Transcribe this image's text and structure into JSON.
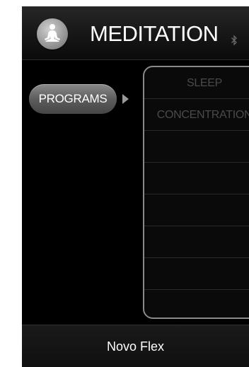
{
  "header": {
    "title": "MEDITATION",
    "logo_icon": "meditation-figure-icon",
    "status_icon": "bluetooth-icon"
  },
  "menu": {
    "selected_tab": "PROGRAMS",
    "arrow_icon": "triangle-right-icon"
  },
  "programs": {
    "items": [
      {
        "label": "SLEEP"
      },
      {
        "label": "CONCENTRATION"
      },
      {
        "label": ""
      },
      {
        "label": ""
      },
      {
        "label": ""
      },
      {
        "label": ""
      },
      {
        "label": ""
      },
      {
        "label": ""
      }
    ]
  },
  "footer": {
    "device_name": "Novo Flex"
  },
  "colors": {
    "background": "#000000",
    "text": "#ffffff",
    "muted_text": "#4a4a4a",
    "panel_border": "#8a8a8a",
    "tab_gradient_top": "#8a8a8a",
    "tab_gradient_bottom": "#454545"
  }
}
